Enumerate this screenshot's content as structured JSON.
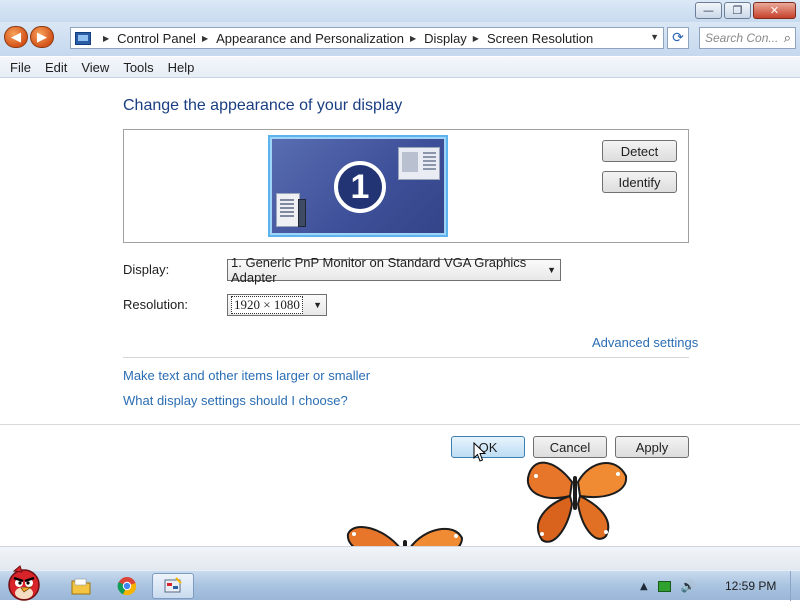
{
  "window": {
    "minimize_glyph": "—",
    "maximize_glyph": "❐",
    "close_glyph": "✕"
  },
  "address_bar": {
    "back_glyph": "◀",
    "forward_glyph": "▶",
    "breadcrumbs": [
      "Control Panel",
      "Appearance and Personalization",
      "Display",
      "Screen Resolution"
    ],
    "separator": "▶",
    "dropdown_glyph": "▼",
    "refresh_glyph": "⟳",
    "search_placeholder": "Search Con...",
    "search_glyph": "⌕"
  },
  "menu": [
    "File",
    "Edit",
    "View",
    "Tools",
    "Help"
  ],
  "main": {
    "heading": "Change the appearance of your display",
    "monitor_number": "1",
    "detect_label": "Detect",
    "identify_label": "Identify",
    "display_label": "Display:",
    "display_value": "1. Generic PnP Monitor on Standard VGA Graphics Adapter",
    "resolution_label": "Resolution:",
    "resolution_value": "1920 × 1080",
    "select_arrow": "▼",
    "advanced_link": "Advanced settings",
    "link_text_size": "Make text and other items larger or smaller",
    "link_help": "What display settings should I choose?",
    "ok_label": "OK",
    "cancel_label": "Cancel",
    "apply_label": "Apply"
  },
  "taskbar": {
    "tray_up_glyph": "▲",
    "speaker_glyph": "🔊",
    "clock": "12:59 PM",
    "pinned_icons": [
      "angry-bird-start-icon",
      "folder-icon",
      "chrome-icon",
      "control-panel-icon"
    ]
  },
  "colors": {
    "heading": "#1a3e82",
    "link": "#2a6db3",
    "monitor_bg": "#3d4f98",
    "accent_orange": "#d4531a"
  }
}
